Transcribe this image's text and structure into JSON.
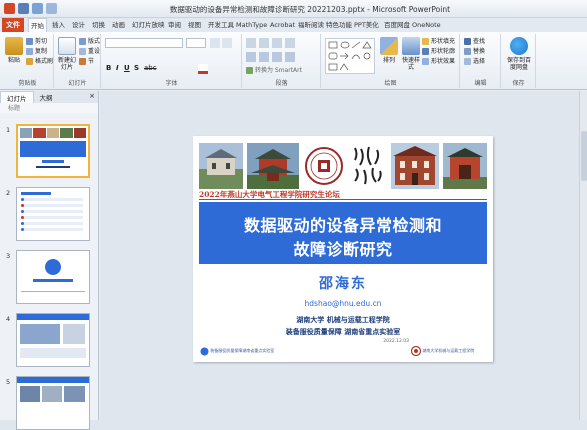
{
  "window": {
    "title": "数据驱动的设备异常检测和故障诊断研究 20221203.pptx - Microsoft PowerPoint"
  },
  "ribbon": {
    "file_tab": "文件",
    "tabs": [
      "开始",
      "插入",
      "设计",
      "切换",
      "动画",
      "幻灯片放映",
      "审阅",
      "视图",
      "开发工具",
      "MathType",
      "Acrobat",
      "福昕阅读",
      "特色功能",
      "PPT美化",
      "百度网盘",
      "OneNote"
    ],
    "active_tab": "开始",
    "clipboard": {
      "paste": "粘贴",
      "cut": "剪切",
      "copy": "复制",
      "format_painter": "格式刷",
      "label": "剪贴板"
    },
    "slides": {
      "new_slide": "新建幻灯片",
      "layout": "版式",
      "reset": "重设",
      "section": "节",
      "label": "幻灯片"
    },
    "font": {
      "label": "字体"
    },
    "paragraph": {
      "convert": "转换为 SmartArt",
      "label": "段落"
    },
    "drawing": {
      "arrange": "排列",
      "quick_styles": "快速样式",
      "fill": "形状填充",
      "outline": "形状轮廓",
      "effects": "形状效果",
      "label": "绘图"
    },
    "editing": {
      "find": "查找",
      "replace": "替换",
      "select": "选择",
      "label": "编辑"
    },
    "baidu": {
      "save": "保存到百度网盘",
      "label": "保存"
    }
  },
  "left_pane": {
    "tab_slides": "幻灯片",
    "tab_outline": "大纲",
    "close": "×",
    "outline_label": "标题",
    "slide_numbers": [
      "1",
      "2",
      "3",
      "4",
      "5"
    ]
  },
  "slide": {
    "conference": "2022年燕山大学电气工程学院研究生论坛",
    "title_line1": "数据驱动的设备异常检测和",
    "title_line2": "故障诊断研究",
    "author": "邵海东",
    "email": "hdshao@hnu.edu.cn",
    "affiliation1": "湖南大学 机械与运载工程学院",
    "affiliation2": "装备服役质量保障 湖南省重点实验室",
    "date": "2022.12.03",
    "logo_left": "装备服役质量保障湖南省重点实验室",
    "logo_right": "湖南大学机械与运载工程学院"
  },
  "colors": {
    "accent_file": "#d24726",
    "banner_blue": "#2e6bd6",
    "conference_red": "#c0392b"
  }
}
